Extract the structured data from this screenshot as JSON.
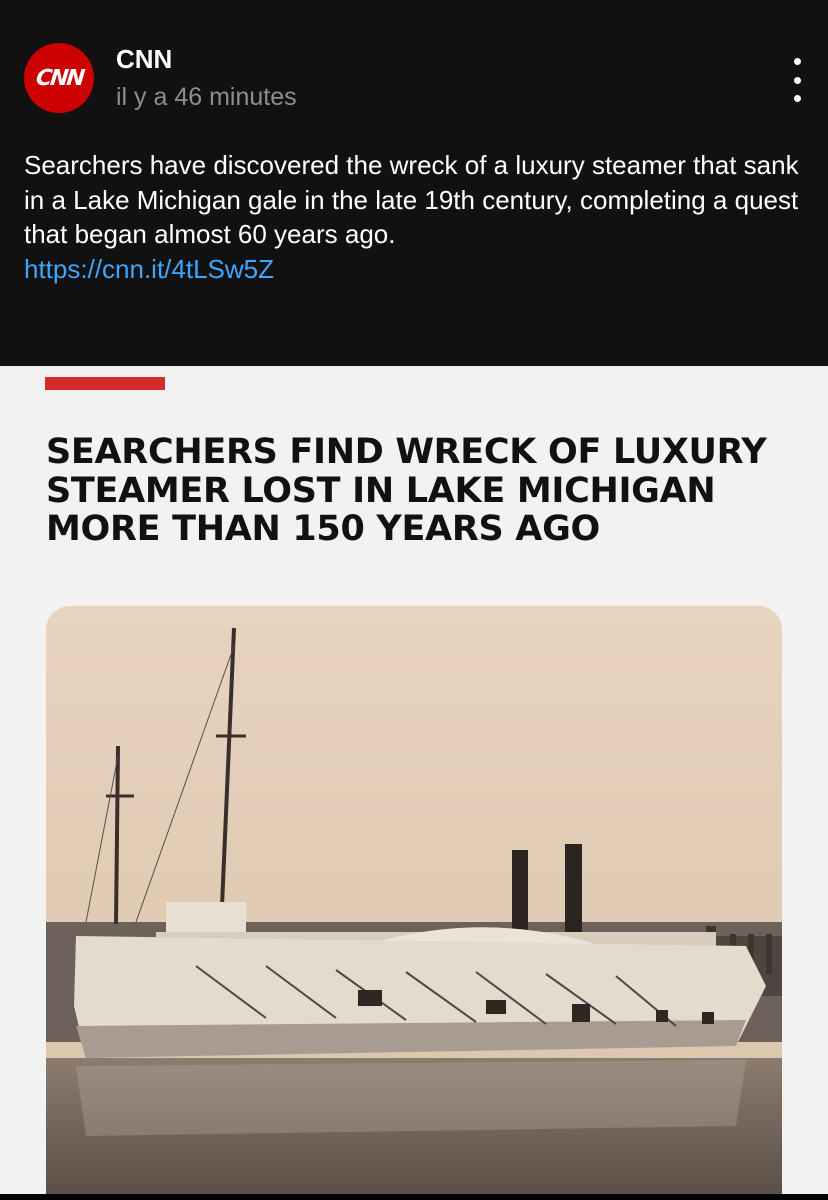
{
  "post": {
    "author": {
      "avatar_text": "CNN",
      "name": "CNN"
    },
    "time": "il y a 46 minutes",
    "caption": "Searchers have discovered the wreck of a luxury steamer that sank in a Lake Michigan gale in the late 19th century, completing a quest that began almost 60 years ago.",
    "link": "https://cnn.it/4tLSw5Z",
    "more_icon": "more-vertical-icon"
  },
  "article": {
    "headline_lines": [
      "SEARCHERS FIND WRECK OF LUXURY",
      "STEAMER LOST IN LAKE MICHIGAN",
      "MORE THAN 150 YEARS AGO"
    ],
    "accent_color": "#d62b2b"
  },
  "colors": {
    "brand": "#cc0000",
    "link": "#3ea6ff",
    "background": "#111111",
    "card": "#f2f2f2"
  }
}
